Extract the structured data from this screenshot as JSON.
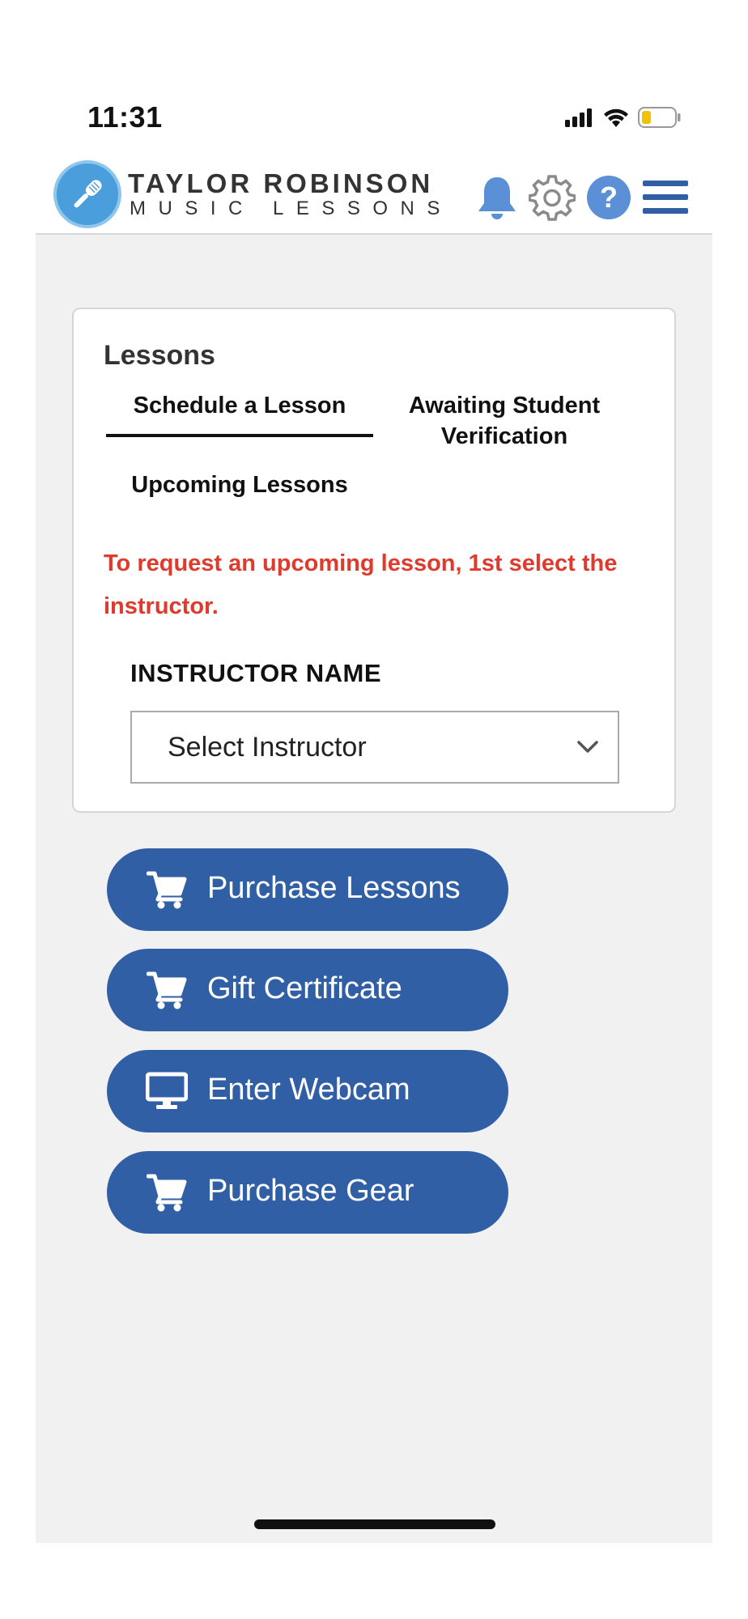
{
  "status_bar": {
    "time": "11:31",
    "icons": [
      "signal-icon",
      "wifi-icon",
      "battery-icon"
    ],
    "battery_color": "#f2c200"
  },
  "header": {
    "brand_line_1": "TAYLOR ROBINSON",
    "brand_line_2": "MUSIC LESSONS",
    "icons": [
      "bell-icon",
      "gear-icon",
      "help-icon",
      "hamburger-menu-icon"
    ],
    "accent_color": "#5b8fd6"
  },
  "lessons_card": {
    "title": "Lessons",
    "tabs": [
      {
        "label": "Schedule a Lesson",
        "active": true
      },
      {
        "label": "Awaiting Student Verification",
        "active": false
      },
      {
        "label": "Upcoming Lessons",
        "active": false
      }
    ],
    "notice": "To request an upcoming lesson, 1st select the instructor.",
    "notice_color": "#e03a2c",
    "instructor_field": {
      "label": "INSTRUCTOR NAME",
      "selected_value": "Select Instructor"
    }
  },
  "actions": [
    {
      "label": "Purchase Lessons",
      "icon": "cart-icon"
    },
    {
      "label": "Gift Certificate",
      "icon": "cart-icon"
    },
    {
      "label": "Enter Webcam",
      "icon": "monitor-icon"
    },
    {
      "label": "Purchase Gear",
      "icon": "cart-icon"
    }
  ],
  "button_color": "#315fa6"
}
